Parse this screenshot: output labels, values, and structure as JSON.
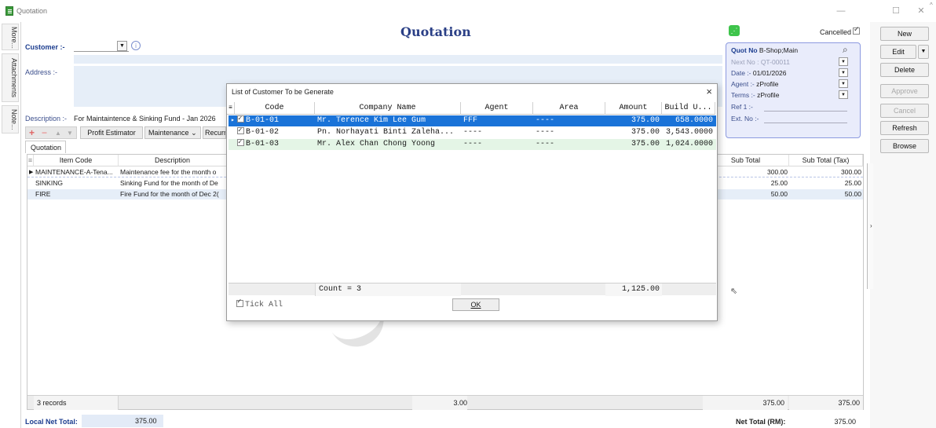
{
  "window": {
    "title": "Quotation"
  },
  "sidetabs": [
    "More...",
    "Attachments",
    "Note..."
  ],
  "form": {
    "heading": "Quotation",
    "customer_label": "Customer :-",
    "address_label": "Address :-",
    "description_label": "Description :-",
    "description_value": "For Maintaintence & Sinking Fund - Jan 2026",
    "toolbar": {
      "profit_estimator": "Profit Estimator",
      "maintenance": "Maintenance",
      "recurring": "Recurri"
    },
    "tab_quotation": "Quotation",
    "cancelled_label": "Cancelled"
  },
  "quote_panel": {
    "quot_no_label": "Quot No",
    "quot_no_value": "B-Shop;Main",
    "next_no_label": "Next No :",
    "next_no_value": "QT-00011",
    "date_label": "Date :-",
    "date_value": "01/01/2026",
    "agent_label": "Agent :-",
    "agent_value": "zProfile",
    "terms_label": "Terms :-",
    "terms_value": "zProfile",
    "ref_label": "Ref 1 :-",
    "ext_label": "Ext. No :-"
  },
  "right_toolbar": {
    "new": "New",
    "edit": "Edit",
    "delete": "Delete",
    "approve": "Approve",
    "cancel": "Cancel",
    "refresh": "Refresh",
    "browse": "Browse"
  },
  "grid": {
    "headers": {
      "item_code": "Item Code",
      "description": "Description",
      "sub_total": "Sub Total",
      "sub_total_tax": "Sub Total (Tax)"
    },
    "rows": [
      {
        "item_code": "MAINTENANCE-A-Tena...",
        "description": "Maintenance fee for the month o",
        "sub_total": "300.00",
        "sub_total_tax": "300.00"
      },
      {
        "item_code": "SINKING",
        "description": "Sinking Fund for the month of De",
        "sub_total": "25.00",
        "sub_total_tax": "25.00"
      },
      {
        "item_code": "FIRE",
        "description": "Fire Fund for the month of Dec 2(",
        "sub_total": "50.00",
        "sub_total_tax": "50.00"
      }
    ],
    "footer": {
      "records": "3 records",
      "qty": "3.00",
      "sub_total": "375.00",
      "sub_total_tax": "375.00"
    }
  },
  "totals": {
    "local_net_total_label": "Local Net Total:",
    "local_net_total_value": "375.00",
    "net_total_label": "Net Total (RM):",
    "net_total_value": "375.00"
  },
  "dialog": {
    "title": "List of Customer To be Generate",
    "headers": {
      "code": "Code",
      "company": "Company Name",
      "agent": "Agent",
      "area": "Area",
      "amount": "Amount",
      "build": "Build U..."
    },
    "rows": [
      {
        "code": "B-01-01",
        "company": "Mr. Terence Kim Lee Gum",
        "agent": "FFF",
        "area": "----",
        "amount": "375.00",
        "build": "658.0000",
        "checked": true
      },
      {
        "code": "B-01-02",
        "company": "Pn. Norhayati Binti Zaleha...",
        "agent": "----",
        "area": "----",
        "amount": "375.00",
        "build": "3,543.0000",
        "checked": true
      },
      {
        "code": "B-01-03",
        "company": "Mr. Alex Chan Chong Yoong",
        "agent": "----",
        "area": "----",
        "amount": "375.00",
        "build": "1,024.0000",
        "checked": true
      }
    ],
    "footer": {
      "count": "Count = 3",
      "amount_total": "1,125.00"
    },
    "tick_all": "Tick All",
    "ok": "OK"
  }
}
